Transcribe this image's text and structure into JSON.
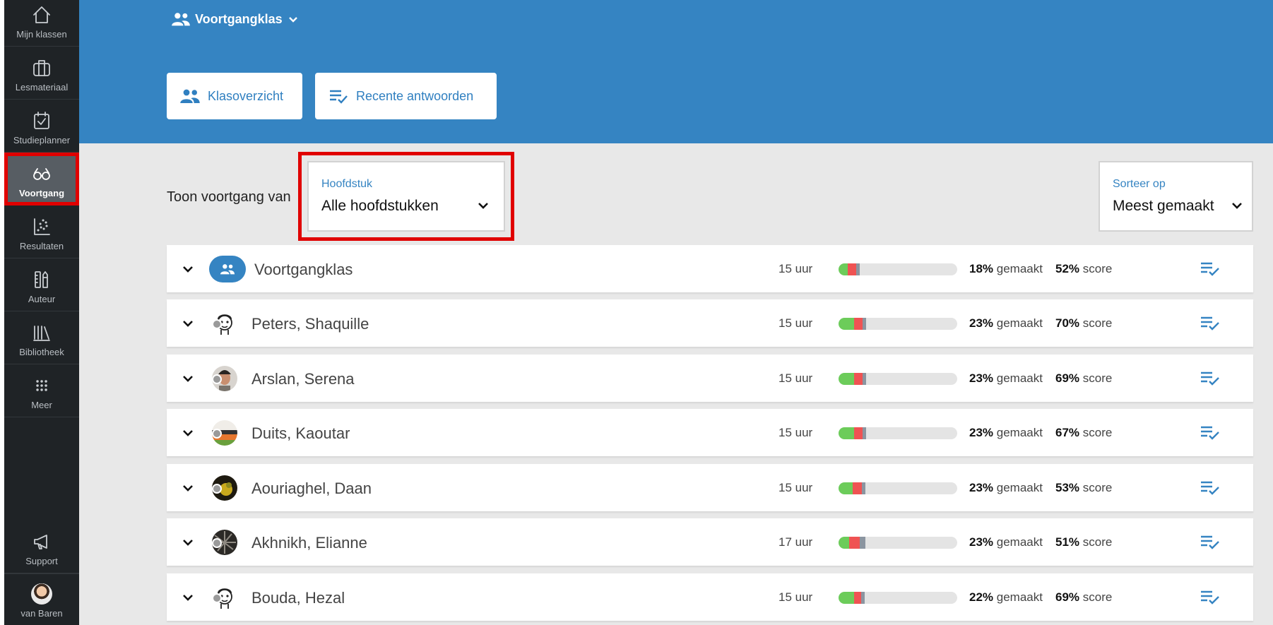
{
  "sidebar": {
    "items": [
      {
        "label": "Mijn klassen",
        "icon": "home-icon"
      },
      {
        "label": "Lesmateriaal",
        "icon": "briefcase-icon"
      },
      {
        "label": "Studieplanner",
        "icon": "calendar-check-icon"
      },
      {
        "label": "Voortgang",
        "icon": "glasses-icon",
        "active": true
      },
      {
        "label": "Resultaten",
        "icon": "scatter-chart-icon"
      },
      {
        "label": "Auteur",
        "icon": "pencil-ruler-icon"
      },
      {
        "label": "Bibliotheek",
        "icon": "books-icon"
      },
      {
        "label": "Meer",
        "icon": "grid-icon"
      }
    ],
    "support_label": "Support",
    "user_label": "van Baren"
  },
  "header": {
    "class_name": "Voortgangklas",
    "btn_overview": "Klasoverzicht",
    "btn_recent": "Recente antwoorden"
  },
  "filters": {
    "toon_label": "Toon voortgang van",
    "chapter_caption": "Hoofdstuk",
    "chapter_value": "Alle hoofdstukken",
    "sort_caption": "Sorteer op",
    "sort_value": "Meest gemaakt"
  },
  "colors": {
    "header_blue": "#3584c2",
    "sidebar_dark": "#1f2326",
    "highlight_red": "#e00000",
    "bar_green": "#6ccc5a",
    "bar_red": "#ef5353",
    "bar_gray": "#8b95a0"
  },
  "rows": [
    {
      "name": "Voortgangklas",
      "type": "group",
      "hours": "15 uur",
      "made_pct": "18%",
      "made_label": "gemaakt",
      "score_pct": "52%",
      "score_label": "score",
      "bar": {
        "green": 0.08,
        "red": 0.07,
        "gray": 0.03
      }
    },
    {
      "name": "Peters, Shaquille",
      "type": "student",
      "avatar": "cartoon",
      "hours": "15 uur",
      "made_pct": "23%",
      "made_label": "gemaakt",
      "score_pct": "70%",
      "score_label": "score",
      "bar": {
        "green": 0.13,
        "red": 0.07,
        "gray": 0.03
      }
    },
    {
      "name": "Arslan, Serena",
      "type": "student",
      "avatar": "photo",
      "hours": "15 uur",
      "made_pct": "23%",
      "made_label": "gemaakt",
      "score_pct": "69%",
      "score_label": "score",
      "bar": {
        "green": 0.13,
        "red": 0.07,
        "gray": 0.03
      }
    },
    {
      "name": "Duits, Kaoutar",
      "type": "student",
      "avatar": "photo2",
      "hours": "15 uur",
      "made_pct": "23%",
      "made_label": "gemaakt",
      "score_pct": "67%",
      "score_label": "score",
      "bar": {
        "green": 0.13,
        "red": 0.07,
        "gray": 0.03
      }
    },
    {
      "name": "Aouriaghel, Daan",
      "type": "student",
      "avatar": "photo3",
      "hours": "15 uur",
      "made_pct": "23%",
      "made_label": "gemaakt",
      "score_pct": "53%",
      "score_label": "score",
      "bar": {
        "green": 0.12,
        "red": 0.08,
        "gray": 0.03
      }
    },
    {
      "name": "Akhnikh, Elianne",
      "type": "student",
      "avatar": "photo4",
      "hours": "17 uur",
      "made_pct": "23%",
      "made_label": "gemaakt",
      "score_pct": "51%",
      "score_label": "score",
      "bar": {
        "green": 0.09,
        "red": 0.09,
        "gray": 0.05
      }
    },
    {
      "name": "Bouda, Hezal",
      "type": "student",
      "avatar": "cartoon",
      "hours": "15 uur",
      "made_pct": "22%",
      "made_label": "gemaakt",
      "score_pct": "69%",
      "score_label": "score",
      "bar": {
        "green": 0.13,
        "red": 0.06,
        "gray": 0.03
      }
    }
  ]
}
